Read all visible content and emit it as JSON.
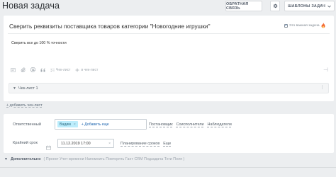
{
  "header": {
    "title": "Новая задача",
    "feedback_label": "ОБРАТНАЯ СВЯЗЬ",
    "templates_label": "ШАБЛОНЫ ЗАДАЧ"
  },
  "task": {
    "title": "Сверить реквизиты поставщика товаров категории \"Новогодние игрушки\"",
    "important_label": "Это важная задача",
    "important_checked": true,
    "description": "Сверить все до 100 % точности"
  },
  "toolbar": {
    "checklist_label": "Чек-лист",
    "in_checklist_label": "в чек-лист"
  },
  "checklist": {
    "title": "Чек-лист 1",
    "add_label": "+ добавить чек-лист"
  },
  "settings": {
    "responsible_label": "Ответственный",
    "responsible_user": "Вадим",
    "add_more_label": "+ Добавить еще",
    "role_links": [
      "Постановщик",
      "Соисполнители",
      "Наблюдатели"
    ],
    "deadline_label": "Крайний срок",
    "deadline_value": "11.12.2019 17:00",
    "plan_links": [
      "Планирование сроков",
      "Еще"
    ]
  },
  "extra": {
    "title": "Дополнительно",
    "items": "( Проект  Учет времени  Напомнить  Повторять  Гант  CRM  Подзадача  Теги  Поля )"
  },
  "colors": {
    "accent": "#2067b0",
    "chip_bg": "#bcedfc",
    "flame": "#f26430"
  }
}
